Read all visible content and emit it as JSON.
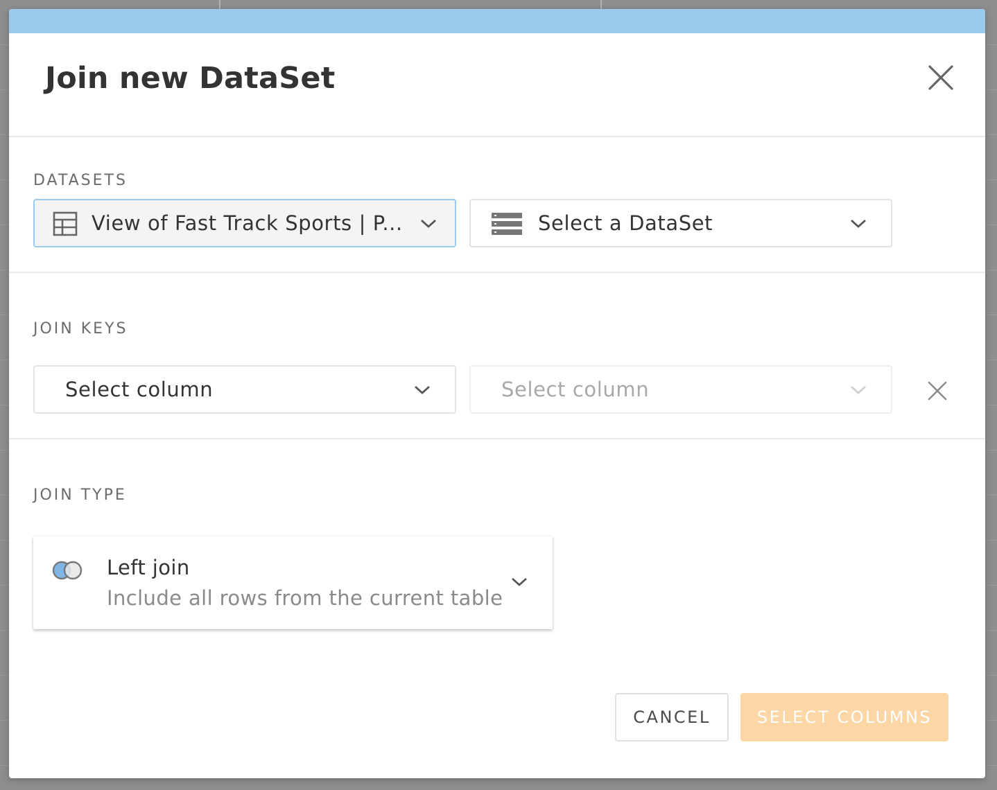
{
  "modal": {
    "title": "Join new DataSet"
  },
  "datasets": {
    "label": "DATASETS",
    "left_select": {
      "value": "View of Fast Track Sports | P...",
      "icon": "table-icon"
    },
    "right_select": {
      "value": "Select a DataSet",
      "icon": "dataset-icon"
    }
  },
  "join_keys": {
    "label": "JOIN KEYS",
    "left_select": {
      "value": "Select column"
    },
    "right_select": {
      "value": "Select column",
      "disabled": true
    }
  },
  "join_type": {
    "label": "JOIN TYPE",
    "selected": {
      "title": "Left join",
      "description": "Include all rows from the current table",
      "icon": "venn-left-join-icon"
    }
  },
  "footer": {
    "cancel_label": "CANCEL",
    "primary_label": "SELECT COLUMNS"
  },
  "colors": {
    "top_bar": "#99cbed",
    "primary_disabled": "#fdd6a6",
    "venn_left_fill": "#7fb6e6"
  }
}
